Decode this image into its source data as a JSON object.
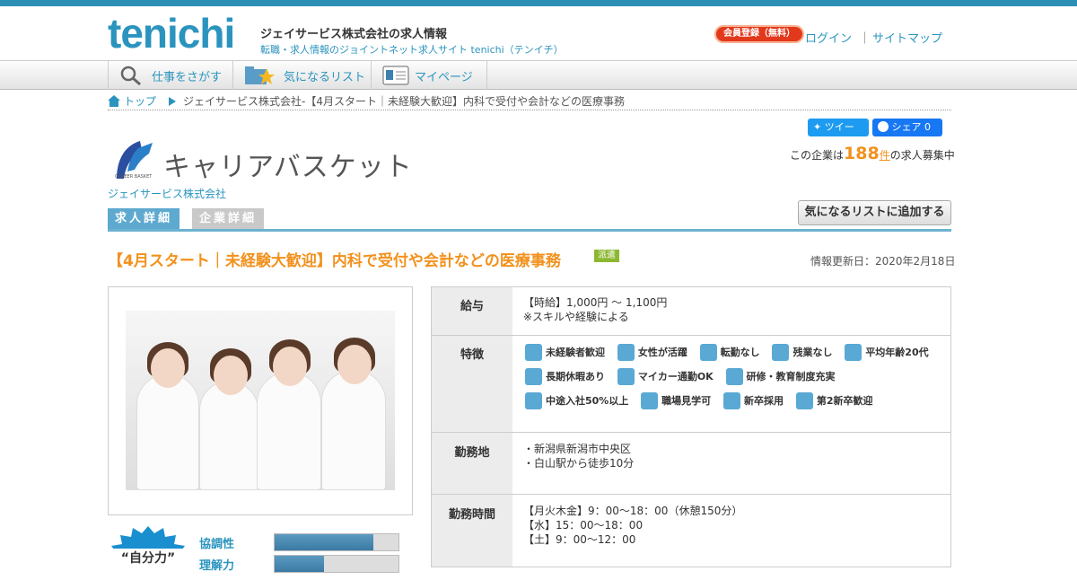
{
  "header": {
    "logo": "tenichi",
    "site_title": "ジェイサービス株式会社の求人情報",
    "site_sub": "転職・求人情報のジョイントネット求人サイト tenichi（テンイチ）",
    "register": "会員登録（無料）",
    "login": "ログイン",
    "sep": "｜",
    "sitemap": "サイトマップ"
  },
  "nav": {
    "search": "仕事をさがす",
    "favorites": "気になるリスト",
    "mypage": "マイページ"
  },
  "breadcrumb": {
    "home": "トップ",
    "current": "ジェイサービス株式会社-【4月スタート｜未経験大歓迎】内科で受付や会計などの医療事務"
  },
  "share": {
    "tweet": "ツイート",
    "fb": "シェア 0"
  },
  "company": {
    "count_prefix": "この企業は",
    "count": "188",
    "count_unit": "件",
    "count_suffix": "の求人募集中",
    "logo_text": "キャリアバスケット",
    "logo_small": "CAREER BASKET",
    "name": "ジェイサービス株式会社"
  },
  "tabs": [
    "求人詳細",
    "企業詳細"
  ],
  "fav_button": "気になるリストに追加する",
  "job": {
    "title": "【4月スタート｜未経験大歓迎】内科で受付や会計などの医療事務",
    "type": "派遣",
    "updated": "情報更新日：2020年2月18日"
  },
  "details": {
    "salary_label": "給与",
    "salary": [
      "【時給】1,000円 ～ 1,100円",
      "※スキルや経験による"
    ],
    "features_label": "特徴",
    "features": [
      {
        "label": "未経験者歓迎",
        "icon": "beginner-icon"
      },
      {
        "label": "女性が活躍",
        "icon": "woman-icon"
      },
      {
        "label": "転勤なし",
        "icon": "no-transfer-icon"
      },
      {
        "label": "残業なし",
        "icon": "no-overtime-icon"
      },
      {
        "label": "平均年齢20代",
        "icon": "age-20s-icon"
      },
      {
        "label": "長期休暇あり",
        "icon": "vacation-icon"
      },
      {
        "label": "マイカー通勤OK",
        "icon": "car-icon"
      },
      {
        "label": "研修・教育制度充実",
        "icon": "training-icon"
      },
      {
        "label": "中途入社50%以上",
        "icon": "midcareer-icon"
      },
      {
        "label": "職場見学可",
        "icon": "tour-icon"
      },
      {
        "label": "新卒採用",
        "icon": "new-grad-icon"
      },
      {
        "label": "第2新卒歓迎",
        "icon": "second-grad-icon"
      }
    ],
    "location_label": "勤務地",
    "location": [
      "・新潟県新潟市中央区",
      "・白山駅から徒歩10分"
    ],
    "hours_label": "勤務時間",
    "hours": [
      "【月火木金】9：00～18：00（休憩150分）",
      "【水】15：00～18：00",
      "【土】9：00～12：00"
    ]
  },
  "power": {
    "badge": "“自分力”",
    "items": [
      {
        "label": "協調性",
        "value": 0.8
      },
      {
        "label": "理解力",
        "value": 0.4
      }
    ]
  }
}
